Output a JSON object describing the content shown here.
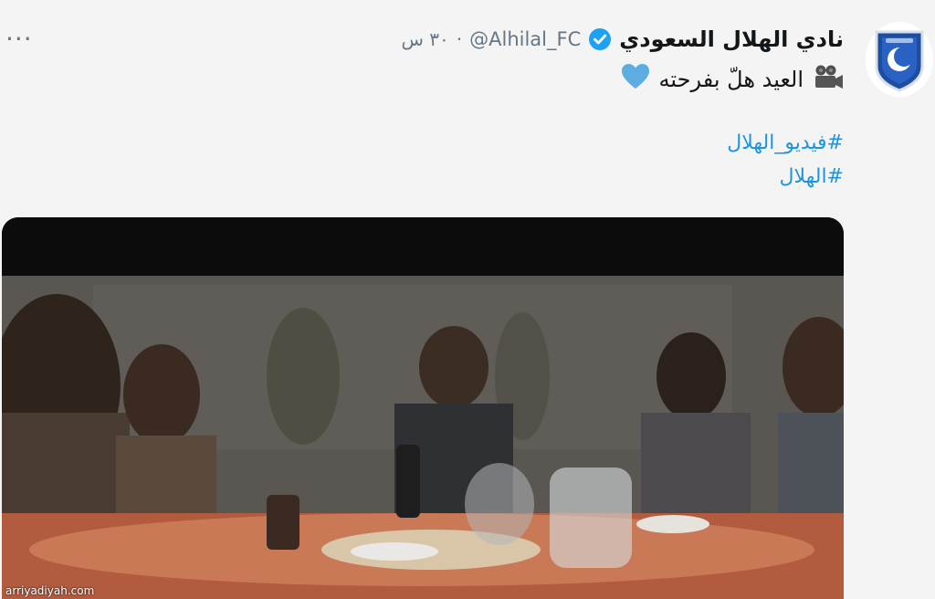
{
  "tweet": {
    "display_name": "نادي الهلال السعودي",
    "handle": "@Alhilal_FC",
    "separator": "·",
    "time": "٣٠ س",
    "more_label": "···",
    "text": "العيد هلّ بفرحته",
    "hashtags": [
      "#فيديو_الهلال",
      "#الهلال"
    ]
  },
  "watermark": "arriyadiyah.com",
  "colors": {
    "link": "#1b95e0",
    "verified": "#1da1f2",
    "heart": "#5dade2",
    "club_blue": "#1c4da1"
  },
  "icons": {
    "verified": "verified-badge-icon",
    "camera": "video-camera-icon",
    "heart": "blue-heart-icon",
    "more": "more-icon",
    "logo": "alhilal-logo"
  }
}
